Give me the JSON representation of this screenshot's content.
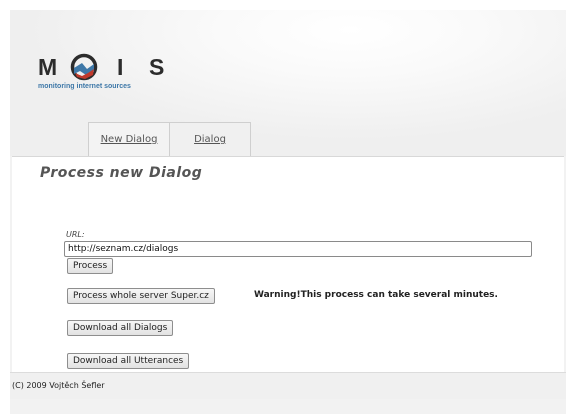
{
  "logo": {
    "letters": [
      "M",
      "O",
      "I",
      "S"
    ],
    "tagline": "monitoring internet sources"
  },
  "tabs": [
    {
      "label": "New Dialog"
    },
    {
      "label": "Dialog"
    }
  ],
  "main": {
    "title": "Process new Dialog",
    "url_label": "URL:",
    "url_value": "http://seznam.cz/dialogs",
    "process_button": "Process",
    "server_button": "Process whole server Super.cz",
    "warning": "Warning!This process can take several minutes.",
    "download_dialogs_button": "Download all Dialogs",
    "download_utterances_button": "Download all Utterances"
  },
  "footer": {
    "text": "(C) 2009 Vojtěch Šefler"
  },
  "colors": {
    "logo_dark": "#2c2c2c",
    "logo_blue": "#3e78a8",
    "logo_red": "#c0392b"
  }
}
